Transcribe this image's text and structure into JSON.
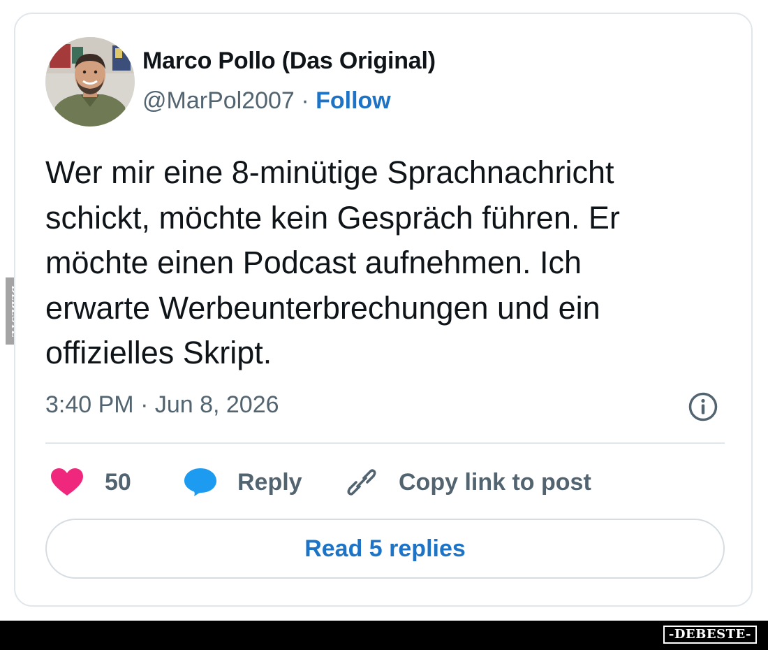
{
  "tweet": {
    "author": {
      "name": "Marco Pollo (Das Original)",
      "handle": "@MarPol2007",
      "separator": "·",
      "follow_label": "Follow"
    },
    "text_lines": [
      "Wer mir eine 8-minütige Sprachnachricht",
      "schickt, möchte kein Gespräch führen. Er",
      "möchte einen Podcast aufnehmen. Ich",
      "erwarte Werbeunterbrechungen und ein",
      "offizielles Skript."
    ],
    "timestamp": "3:40 PM · Jun 8, 2026",
    "actions": {
      "like_count": "50",
      "reply_label": "Reply",
      "copy_label": "Copy link to post"
    },
    "read_replies_label": "Read 5 replies"
  },
  "watermark": {
    "side_text": "DEBESTE",
    "brand_text": "-DEBESTE-"
  },
  "colors": {
    "accent_blue": "#1d74c7",
    "like_pink": "#f0287d",
    "reply_blue": "#1d9bf0",
    "text_primary": "#0f1419",
    "text_secondary": "#536471",
    "border": "#e1e6ea"
  },
  "icons": {
    "avatar": "profile-photo",
    "info": "info-circle-icon",
    "like": "heart-icon",
    "reply": "speech-bubble-icon",
    "copy": "link-icon"
  }
}
